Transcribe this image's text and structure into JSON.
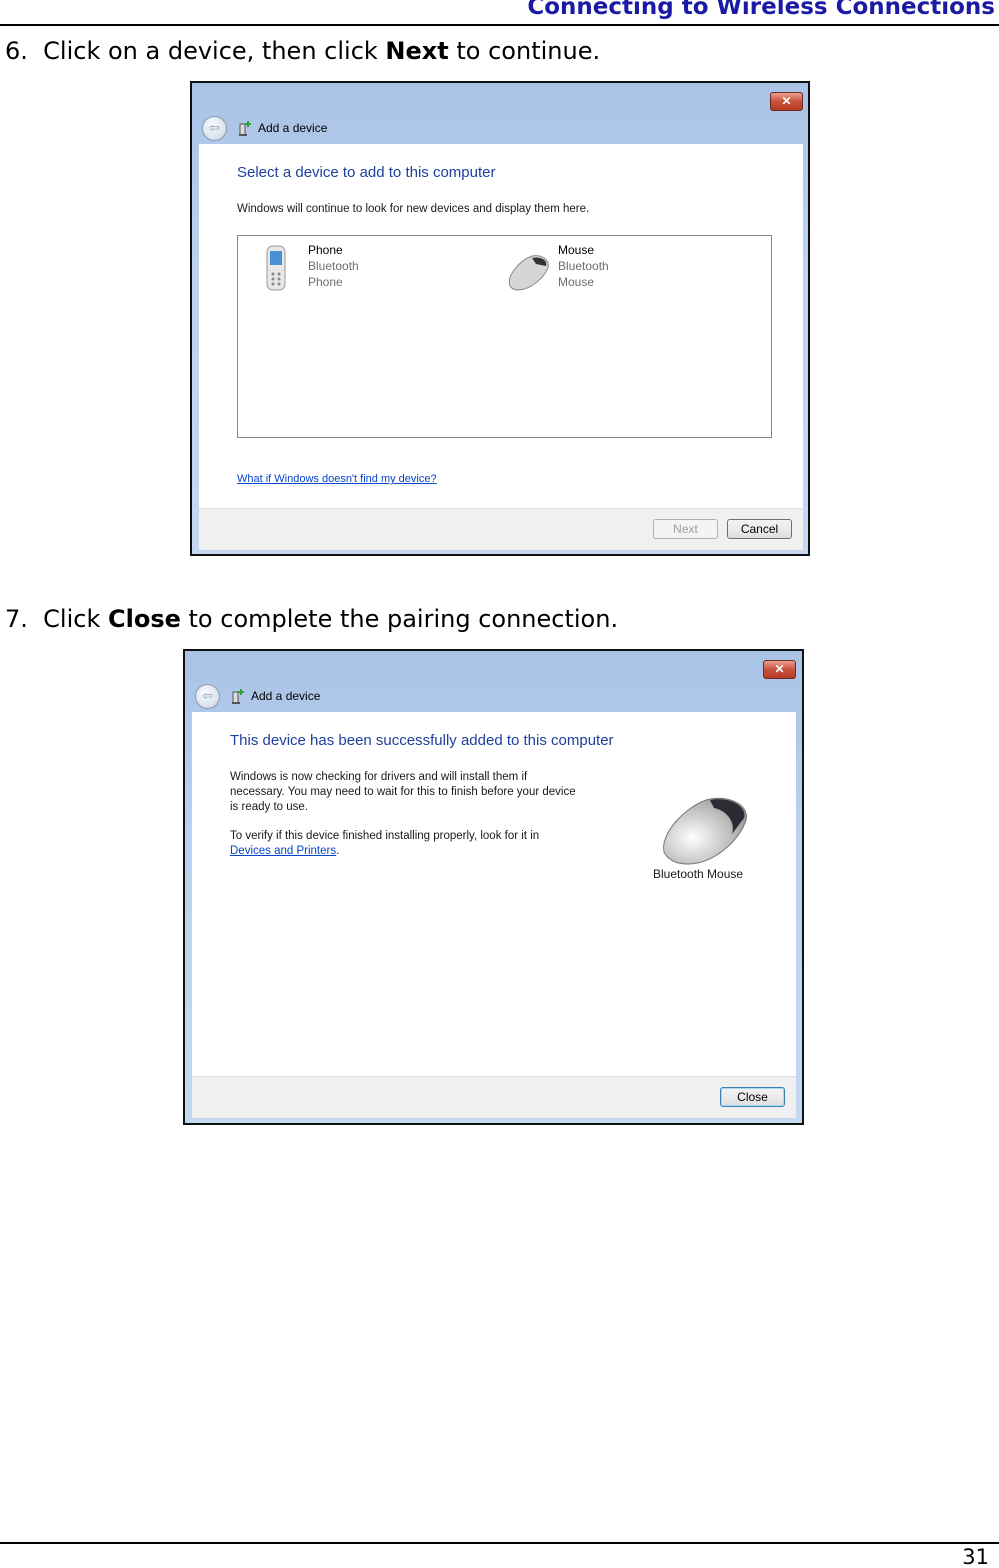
{
  "header": {
    "title": "Connecting to Wireless Connections"
  },
  "steps": [
    {
      "number": "6.",
      "pre": "Click on a device, then click ",
      "bold": "Next",
      "post": " to continue."
    },
    {
      "number": "7.",
      "pre": "Click ",
      "bold": "Close",
      "post": " to complete the pairing connection."
    }
  ],
  "dialog1": {
    "title": "Add a device",
    "close_glyph": "✕",
    "heading": "Select a device to add to this computer",
    "description": "Windows will continue to look for new devices and display them here.",
    "devices": [
      {
        "name": "Phone",
        "type": "Bluetooth",
        "category": "Phone",
        "icon": "phone-icon"
      },
      {
        "name": "Mouse",
        "type": "Bluetooth",
        "category": "Mouse",
        "icon": "mouse-icon"
      }
    ],
    "help_link": "What if Windows doesn't find my device?",
    "next_label": "Next",
    "cancel_label": "Cancel"
  },
  "dialog2": {
    "title": "Add a device",
    "close_glyph": "✕",
    "heading": "This device has been successfully added to this computer",
    "para1": [
      "Windows is now checking for drivers and will install them if",
      "necessary. You may need to wait for this to finish before your device",
      "is ready to use."
    ],
    "para2": "To verify if this device finished installing properly, look for it in",
    "link": "Devices and Printers",
    "link_suffix": ".",
    "device_label": "Bluetooth Mouse",
    "close_label": "Close"
  },
  "footer": {
    "page_number": "31"
  },
  "colors": {
    "header": "#1a1aa6",
    "heading": "#1e3f9e",
    "link": "#0645c8"
  }
}
